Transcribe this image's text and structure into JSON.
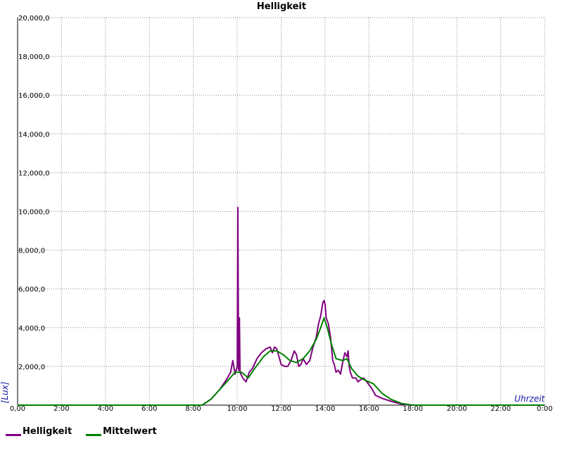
{
  "chart_data": {
    "type": "line",
    "title": "Helligkeit",
    "xlabel": "Uhrzeit",
    "ylabel": "[Lux]",
    "xlim": [
      0,
      24
    ],
    "ylim": [
      0,
      20000
    ],
    "grid": true,
    "legend_position": "bottom-left",
    "x_ticks": [
      "0,00",
      "2:00",
      "4:00",
      "6:00",
      "8:00",
      "10:00",
      "12:00",
      "14:00",
      "16:00",
      "18:00",
      "20:00",
      "22:00",
      "0:00"
    ],
    "y_ticks": [
      "2,000,0",
      "4,000,0",
      "6,000,0",
      "8,000,0",
      "10,000,0",
      "12,000,0",
      "14,000,0",
      "16,000,0",
      "18,000,0",
      "20,000,0"
    ],
    "series": [
      {
        "name": "Helligkeit",
        "color": "#800080",
        "x": [
          0,
          8.4,
          8.8,
          9.2,
          9.5,
          9.7,
          9.8,
          9.9,
          10.0,
          10.03,
          10.06,
          10.1,
          10.13,
          10.17,
          10.25,
          10.4,
          10.55,
          10.7,
          10.9,
          11.1,
          11.3,
          11.5,
          11.6,
          11.7,
          11.8,
          11.9,
          12.0,
          12.15,
          12.3,
          12.45,
          12.6,
          12.7,
          12.8,
          12.9,
          13.0,
          13.05,
          13.15,
          13.3,
          13.45,
          13.6,
          13.7,
          13.8,
          13.9,
          13.95,
          14.0,
          14.05,
          14.15,
          14.25,
          14.35,
          14.42,
          14.5,
          14.6,
          14.7,
          14.8,
          14.9,
          15.0,
          15.05,
          15.1,
          15.15,
          15.25,
          15.4,
          15.5,
          15.6,
          15.75,
          15.9,
          16.1,
          16.3,
          16.6,
          17.0,
          17.5,
          17.9,
          18.2,
          24
        ],
        "values": [
          0,
          0,
          300,
          800,
          1300,
          1700,
          2300,
          1600,
          2000,
          10200,
          1800,
          4500,
          1700,
          1600,
          1400,
          1200,
          1700,
          1900,
          2400,
          2700,
          2900,
          3000,
          2700,
          3000,
          2900,
          2500,
          2100,
          2000,
          2000,
          2300,
          2800,
          2600,
          2000,
          2100,
          2400,
          2300,
          2100,
          2300,
          3000,
          3500,
          4200,
          4600,
          5300,
          5400,
          5200,
          4500,
          4200,
          3500,
          2300,
          2100,
          1700,
          1800,
          1600,
          2200,
          2700,
          2500,
          2800,
          2000,
          1700,
          1400,
          1400,
          1200,
          1300,
          1400,
          1200,
          900,
          500,
          350,
          200,
          50,
          0,
          0,
          0
        ]
      },
      {
        "name": "Mittelwert",
        "color": "#008000",
        "x": [
          0,
          8.4,
          8.8,
          9.2,
          9.6,
          9.9,
          10.2,
          10.5,
          10.8,
          11.2,
          11.5,
          11.8,
          12.1,
          12.4,
          12.7,
          13.0,
          13.3,
          13.6,
          13.8,
          13.95,
          14.1,
          14.3,
          14.5,
          14.8,
          15.0,
          15.2,
          15.5,
          15.8,
          16.2,
          16.6,
          17.0,
          17.5,
          18.0,
          24
        ],
        "values": [
          0,
          0,
          300,
          800,
          1300,
          1700,
          1700,
          1400,
          1900,
          2500,
          2800,
          2800,
          2600,
          2300,
          2200,
          2400,
          2800,
          3400,
          4000,
          4500,
          4000,
          3100,
          2400,
          2300,
          2400,
          1900,
          1500,
          1300,
          1100,
          600,
          300,
          80,
          0,
          0
        ]
      }
    ]
  }
}
